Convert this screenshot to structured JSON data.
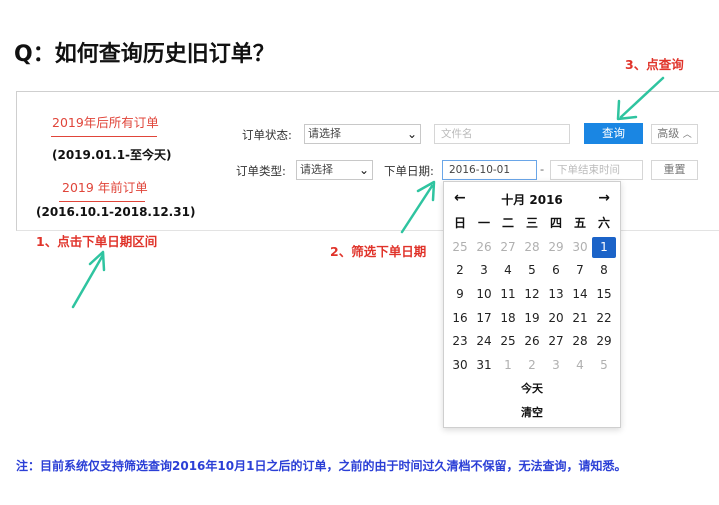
{
  "title": "Q：如何查询历史旧订单？",
  "side": {
    "tab1": "2019年后所有订单",
    "range1": "(2019.01.1-至今天)",
    "tab2": "2019 年前订单",
    "range2": "(2016.10.1-2018.12.31)"
  },
  "filters": {
    "status_label": "订单状态:",
    "status_value": "请选择",
    "file_placeholder": "文件名",
    "search_label": "查询",
    "advanced_label": "高级",
    "type_label": "订单类型:",
    "type_value": "请选择",
    "date_label": "下单日期:",
    "date_start": "2016-10-01",
    "date_sep": "-",
    "date_end_placeholder": "下单结束时间",
    "reset_label": "重置"
  },
  "calendar": {
    "title": "十月 2016",
    "weekdays": [
      "日",
      "一",
      "二",
      "三",
      "四",
      "五",
      "六"
    ],
    "weeks": [
      [
        {
          "d": "25",
          "m": true
        },
        {
          "d": "26",
          "m": true
        },
        {
          "d": "27",
          "m": true
        },
        {
          "d": "28",
          "m": true
        },
        {
          "d": "29",
          "m": true
        },
        {
          "d": "30",
          "m": true
        },
        {
          "d": "1",
          "sel": true
        }
      ],
      [
        {
          "d": "2"
        },
        {
          "d": "3"
        },
        {
          "d": "4"
        },
        {
          "d": "5"
        },
        {
          "d": "6"
        },
        {
          "d": "7"
        },
        {
          "d": "8"
        }
      ],
      [
        {
          "d": "9"
        },
        {
          "d": "10"
        },
        {
          "d": "11"
        },
        {
          "d": "12"
        },
        {
          "d": "13"
        },
        {
          "d": "14"
        },
        {
          "d": "15"
        }
      ],
      [
        {
          "d": "16"
        },
        {
          "d": "17"
        },
        {
          "d": "18"
        },
        {
          "d": "19"
        },
        {
          "d": "20"
        },
        {
          "d": "21"
        },
        {
          "d": "22"
        }
      ],
      [
        {
          "d": "23"
        },
        {
          "d": "24"
        },
        {
          "d": "25"
        },
        {
          "d": "26"
        },
        {
          "d": "27"
        },
        {
          "d": "28"
        },
        {
          "d": "29"
        }
      ],
      [
        {
          "d": "30"
        },
        {
          "d": "31"
        },
        {
          "d": "1",
          "m": true
        },
        {
          "d": "2",
          "m": true
        },
        {
          "d": "3",
          "m": true
        },
        {
          "d": "4",
          "m": true
        },
        {
          "d": "5",
          "m": true
        }
      ]
    ],
    "today_label": "今天",
    "clear_label": "清空"
  },
  "annotations": {
    "step1": "1、点击下单日期区间",
    "step2": "2、筛选下单日期",
    "step3": "3、点查询"
  },
  "note": "注：目前系统仅支持筛选查询2016年10月1日之后的订单，之前的由于时间过久清档不保留，无法查询，请知悉。",
  "colors": {
    "accent_red": "#e0332a",
    "button_blue": "#1a86e3",
    "selected_day": "#1b63c8",
    "arrow_green": "#2fc4a0",
    "note_blue": "#2b3fd6"
  }
}
